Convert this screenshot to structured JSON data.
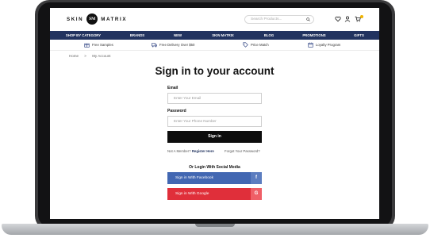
{
  "header": {
    "logo_left": "SKIN",
    "logo_badge": "SM",
    "logo_right": "MATRIX",
    "search_placeholder": "Search Products...",
    "icons": [
      "heart-icon",
      "user-icon",
      "cart-icon"
    ]
  },
  "nav": {
    "items": [
      {
        "label": "SHOP BY CATEGORY"
      },
      {
        "label": "BRANDS"
      },
      {
        "label": "NEW"
      },
      {
        "label": "SKIN MATRIX"
      },
      {
        "label": "BLOG"
      },
      {
        "label": "PROMOTIONS"
      },
      {
        "label": "GIFTS"
      }
    ]
  },
  "perks": [
    {
      "label": "Free Samples",
      "icon": "gift-icon"
    },
    {
      "label": "Free Delivery Over $50",
      "icon": "truck-icon"
    },
    {
      "label": "Price Match",
      "icon": "price-tag-icon"
    },
    {
      "label": "Loyalty Program",
      "icon": "calendar-icon"
    }
  ],
  "breadcrumb": {
    "home": "Home",
    "separator": ">",
    "current": "My Account"
  },
  "form": {
    "title": "Sign in to your account",
    "email_label": "Email",
    "email_placeholder": "Enter Your Email",
    "password_label": "Password",
    "password_placeholder": "Enter Your Phone Number",
    "submit_label": "Sign in",
    "not_member_text": "Not A Member?",
    "register_link": "Register Here",
    "forgot_link": "Forgot Your Password?"
  },
  "social": {
    "heading": "Or Login With Social Media",
    "facebook_label": "Sign in With Facebook",
    "facebook_icon_glyph": "f",
    "google_label": "Sign in With Google",
    "google_icon_glyph": "G"
  },
  "colors": {
    "nav_bg": "#22335f",
    "facebook": "#4267b2",
    "google": "#e02f3a",
    "badge": "#f0b400"
  }
}
